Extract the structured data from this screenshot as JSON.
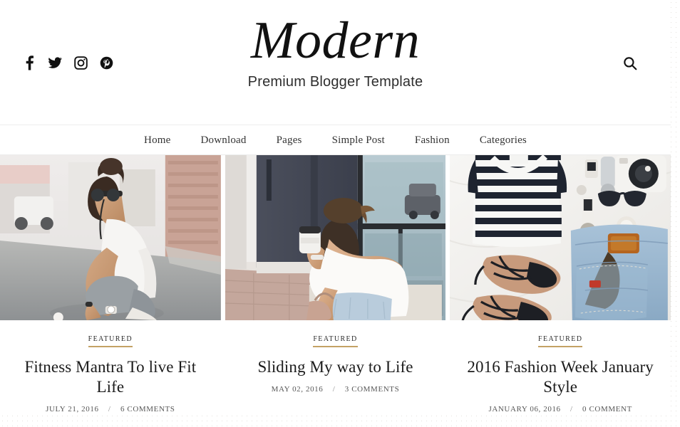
{
  "header": {
    "site_title": "Modern",
    "tagline": "Premium Blogger Template",
    "search_label": "Search",
    "social": [
      {
        "name": "facebook",
        "label": "Facebook"
      },
      {
        "name": "twitter",
        "label": "Twitter"
      },
      {
        "name": "instagram",
        "label": "Instagram"
      },
      {
        "name": "pinterest",
        "label": "Pinterest"
      }
    ]
  },
  "nav": {
    "items": [
      {
        "label": "Home"
      },
      {
        "label": "Download"
      },
      {
        "label": "Pages"
      },
      {
        "label": "Simple Post"
      },
      {
        "label": "Fashion"
      },
      {
        "label": "Categories"
      }
    ]
  },
  "posts": [
    {
      "label": "FEATURED",
      "title": "Fitness Mantra To live Fit Life",
      "date": "JULY 21, 2016",
      "separator": "/",
      "comments": "6 COMMENTS",
      "image_alt": "Woman in white tank top and denim shorts crouching on a city street with earbuds and sunglasses"
    },
    {
      "label": "FEATURED",
      "title": "Sliding My way to Life",
      "date": "MAY 02, 2016",
      "separator": "/",
      "comments": "3 COMMENTS",
      "image_alt": "Woman seen from behind in white off-shoulder top holding a coffee cup beside a dark navy wall and window"
    },
    {
      "label": "FEATURED",
      "title": "2016 Fashion Week January Style",
      "date": "JANUARY 06, 2016",
      "separator": "/",
      "comments": "0 COMMENT",
      "image_alt": "Flatlay of striped shirt, lace-up flats, denim jeans, camera and sunglasses on white bedding"
    }
  ],
  "colors": {
    "accent_underline": "#c4a265",
    "text_primary": "#1b1b1b",
    "text_meta": "#565656",
    "page_background": "#ffffff"
  }
}
